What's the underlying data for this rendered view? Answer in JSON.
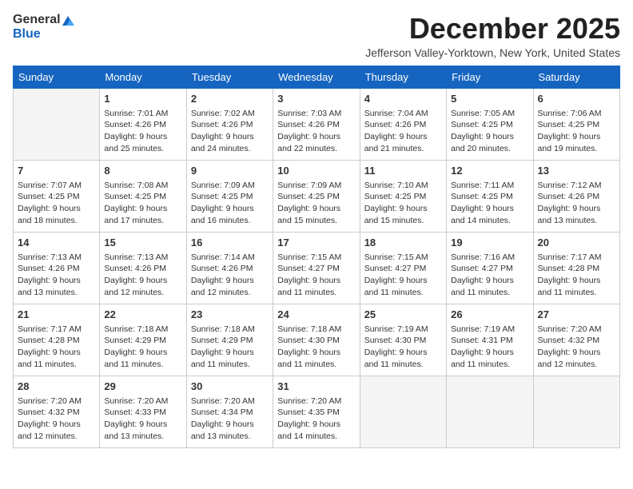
{
  "header": {
    "logo_general": "General",
    "logo_blue": "Blue",
    "month_title": "December 2025",
    "location": "Jefferson Valley-Yorktown, New York, United States"
  },
  "weekdays": [
    "Sunday",
    "Monday",
    "Tuesday",
    "Wednesday",
    "Thursday",
    "Friday",
    "Saturday"
  ],
  "weeks": [
    [
      {
        "day": "",
        "sunrise": "",
        "sunset": "",
        "daylight": ""
      },
      {
        "day": "1",
        "sunrise": "Sunrise: 7:01 AM",
        "sunset": "Sunset: 4:26 PM",
        "daylight": "Daylight: 9 hours and 25 minutes."
      },
      {
        "day": "2",
        "sunrise": "Sunrise: 7:02 AM",
        "sunset": "Sunset: 4:26 PM",
        "daylight": "Daylight: 9 hours and 24 minutes."
      },
      {
        "day": "3",
        "sunrise": "Sunrise: 7:03 AM",
        "sunset": "Sunset: 4:26 PM",
        "daylight": "Daylight: 9 hours and 22 minutes."
      },
      {
        "day": "4",
        "sunrise": "Sunrise: 7:04 AM",
        "sunset": "Sunset: 4:26 PM",
        "daylight": "Daylight: 9 hours and 21 minutes."
      },
      {
        "day": "5",
        "sunrise": "Sunrise: 7:05 AM",
        "sunset": "Sunset: 4:25 PM",
        "daylight": "Daylight: 9 hours and 20 minutes."
      },
      {
        "day": "6",
        "sunrise": "Sunrise: 7:06 AM",
        "sunset": "Sunset: 4:25 PM",
        "daylight": "Daylight: 9 hours and 19 minutes."
      }
    ],
    [
      {
        "day": "7",
        "sunrise": "Sunrise: 7:07 AM",
        "sunset": "Sunset: 4:25 PM",
        "daylight": "Daylight: 9 hours and 18 minutes."
      },
      {
        "day": "8",
        "sunrise": "Sunrise: 7:08 AM",
        "sunset": "Sunset: 4:25 PM",
        "daylight": "Daylight: 9 hours and 17 minutes."
      },
      {
        "day": "9",
        "sunrise": "Sunrise: 7:09 AM",
        "sunset": "Sunset: 4:25 PM",
        "daylight": "Daylight: 9 hours and 16 minutes."
      },
      {
        "day": "10",
        "sunrise": "Sunrise: 7:09 AM",
        "sunset": "Sunset: 4:25 PM",
        "daylight": "Daylight: 9 hours and 15 minutes."
      },
      {
        "day": "11",
        "sunrise": "Sunrise: 7:10 AM",
        "sunset": "Sunset: 4:25 PM",
        "daylight": "Daylight: 9 hours and 15 minutes."
      },
      {
        "day": "12",
        "sunrise": "Sunrise: 7:11 AM",
        "sunset": "Sunset: 4:25 PM",
        "daylight": "Daylight: 9 hours and 14 minutes."
      },
      {
        "day": "13",
        "sunrise": "Sunrise: 7:12 AM",
        "sunset": "Sunset: 4:26 PM",
        "daylight": "Daylight: 9 hours and 13 minutes."
      }
    ],
    [
      {
        "day": "14",
        "sunrise": "Sunrise: 7:13 AM",
        "sunset": "Sunset: 4:26 PM",
        "daylight": "Daylight: 9 hours and 13 minutes."
      },
      {
        "day": "15",
        "sunrise": "Sunrise: 7:13 AM",
        "sunset": "Sunset: 4:26 PM",
        "daylight": "Daylight: 9 hours and 12 minutes."
      },
      {
        "day": "16",
        "sunrise": "Sunrise: 7:14 AM",
        "sunset": "Sunset: 4:26 PM",
        "daylight": "Daylight: 9 hours and 12 minutes."
      },
      {
        "day": "17",
        "sunrise": "Sunrise: 7:15 AM",
        "sunset": "Sunset: 4:27 PM",
        "daylight": "Daylight: 9 hours and 11 minutes."
      },
      {
        "day": "18",
        "sunrise": "Sunrise: 7:15 AM",
        "sunset": "Sunset: 4:27 PM",
        "daylight": "Daylight: 9 hours and 11 minutes."
      },
      {
        "day": "19",
        "sunrise": "Sunrise: 7:16 AM",
        "sunset": "Sunset: 4:27 PM",
        "daylight": "Daylight: 9 hours and 11 minutes."
      },
      {
        "day": "20",
        "sunrise": "Sunrise: 7:17 AM",
        "sunset": "Sunset: 4:28 PM",
        "daylight": "Daylight: 9 hours and 11 minutes."
      }
    ],
    [
      {
        "day": "21",
        "sunrise": "Sunrise: 7:17 AM",
        "sunset": "Sunset: 4:28 PM",
        "daylight": "Daylight: 9 hours and 11 minutes."
      },
      {
        "day": "22",
        "sunrise": "Sunrise: 7:18 AM",
        "sunset": "Sunset: 4:29 PM",
        "daylight": "Daylight: 9 hours and 11 minutes."
      },
      {
        "day": "23",
        "sunrise": "Sunrise: 7:18 AM",
        "sunset": "Sunset: 4:29 PM",
        "daylight": "Daylight: 9 hours and 11 minutes."
      },
      {
        "day": "24",
        "sunrise": "Sunrise: 7:18 AM",
        "sunset": "Sunset: 4:30 PM",
        "daylight": "Daylight: 9 hours and 11 minutes."
      },
      {
        "day": "25",
        "sunrise": "Sunrise: 7:19 AM",
        "sunset": "Sunset: 4:30 PM",
        "daylight": "Daylight: 9 hours and 11 minutes."
      },
      {
        "day": "26",
        "sunrise": "Sunrise: 7:19 AM",
        "sunset": "Sunset: 4:31 PM",
        "daylight": "Daylight: 9 hours and 11 minutes."
      },
      {
        "day": "27",
        "sunrise": "Sunrise: 7:20 AM",
        "sunset": "Sunset: 4:32 PM",
        "daylight": "Daylight: 9 hours and 12 minutes."
      }
    ],
    [
      {
        "day": "28",
        "sunrise": "Sunrise: 7:20 AM",
        "sunset": "Sunset: 4:32 PM",
        "daylight": "Daylight: 9 hours and 12 minutes."
      },
      {
        "day": "29",
        "sunrise": "Sunrise: 7:20 AM",
        "sunset": "Sunset: 4:33 PM",
        "daylight": "Daylight: 9 hours and 13 minutes."
      },
      {
        "day": "30",
        "sunrise": "Sunrise: 7:20 AM",
        "sunset": "Sunset: 4:34 PM",
        "daylight": "Daylight: 9 hours and 13 minutes."
      },
      {
        "day": "31",
        "sunrise": "Sunrise: 7:20 AM",
        "sunset": "Sunset: 4:35 PM",
        "daylight": "Daylight: 9 hours and 14 minutes."
      },
      {
        "day": "",
        "sunrise": "",
        "sunset": "",
        "daylight": ""
      },
      {
        "day": "",
        "sunrise": "",
        "sunset": "",
        "daylight": ""
      },
      {
        "day": "",
        "sunrise": "",
        "sunset": "",
        "daylight": ""
      }
    ]
  ]
}
